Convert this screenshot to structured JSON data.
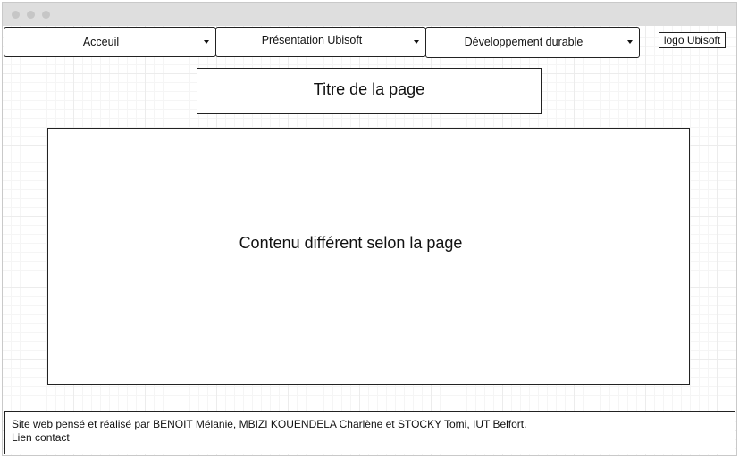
{
  "window": {
    "dots": [
      "close",
      "minimize",
      "maximize"
    ]
  },
  "nav": {
    "items": [
      {
        "label": "Acceuil"
      },
      {
        "label": "Présentation Ubisoft"
      },
      {
        "label": "Développement durable"
      }
    ],
    "logo": "logo Ubisoft"
  },
  "page": {
    "title": "Titre de la page",
    "content": "Contenu différent selon la page"
  },
  "footer": {
    "credits": "Site web pensé et réalisé par BENOIT Mélanie, MBIZI KOUENDELA Charlène et STOCKY Tomi, IUT Belfort.",
    "contact": "Lien contact"
  },
  "colors": {
    "titlebar": "#dedede",
    "grid": "#ececec",
    "border": "#222222"
  }
}
